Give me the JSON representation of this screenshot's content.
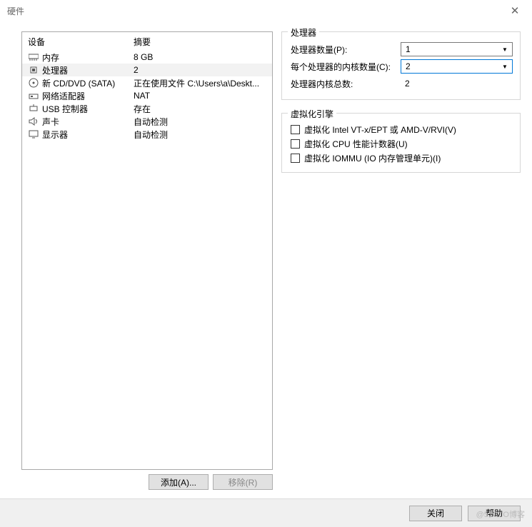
{
  "window": {
    "title": "硬件",
    "close_glyph": "✕"
  },
  "deviceList": {
    "headers": {
      "device": "设备",
      "summary": "摘要"
    },
    "items": [
      {
        "icon": "memory-icon",
        "name": "内存",
        "summary": "8 GB",
        "selected": false
      },
      {
        "icon": "cpu-icon",
        "name": "处理器",
        "summary": "2",
        "selected": true
      },
      {
        "icon": "cd-icon",
        "name": "新 CD/DVD (SATA)",
        "summary": "正在使用文件 C:\\Users\\a\\Deskt...",
        "selected": false
      },
      {
        "icon": "network-icon",
        "name": "网络适配器",
        "summary": "NAT",
        "selected": false
      },
      {
        "icon": "usb-icon",
        "name": "USB 控制器",
        "summary": "存在",
        "selected": false
      },
      {
        "icon": "sound-icon",
        "name": "声卡",
        "summary": "自动检测",
        "selected": false
      },
      {
        "icon": "display-icon",
        "name": "显示器",
        "summary": "自动检测",
        "selected": false
      }
    ],
    "addLabel": "添加(A)...",
    "removeLabel": "移除(R)"
  },
  "processorGroup": {
    "legend": "处理器",
    "countLabel": "处理器数量(P):",
    "countValue": "1",
    "coresLabel": "每个处理器的内核数量(C):",
    "coresValue": "2",
    "totalLabel": "处理器内核总数:",
    "totalValue": "2"
  },
  "virtGroup": {
    "legend": "虚拟化引擎",
    "opts": [
      "虚拟化 Intel VT-x/EPT 或 AMD-V/RVI(V)",
      "虚拟化 CPU 性能计数器(U)",
      "虚拟化 IOMMU (IO 内存管理单元)(I)"
    ]
  },
  "footer": {
    "close": "关闭",
    "help": "帮助"
  },
  "watermark": "@51CTO博客"
}
